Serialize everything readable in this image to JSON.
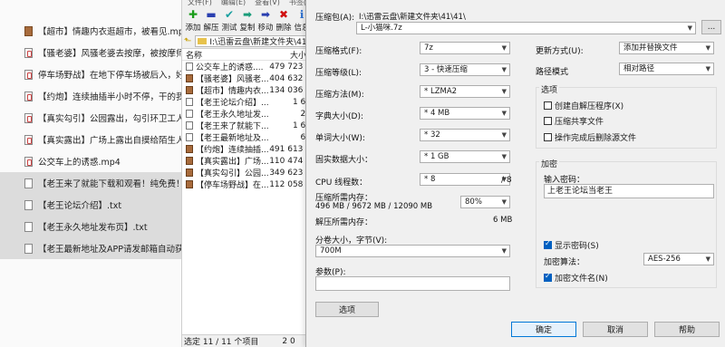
{
  "explorer": {
    "rows": [
      {
        "name": "【超市】情趣内衣逛超市，被看见.mp4",
        "type": "img",
        "selected": false
      },
      {
        "name": "【骚老婆】风骚老婆去按摩，被按摩师拿命",
        "type": "vid",
        "selected": false
      },
      {
        "name": "停车场野战】在地下停车场被后入，好刺激",
        "type": "vid",
        "selected": false
      },
      {
        "name": "【约炮】连续抽插半小时不停，干的我高潮",
        "type": "vid",
        "selected": false
      },
      {
        "name": "【真实勾引】公园露出，勾引环卫工人干我",
        "type": "vid",
        "selected": false
      },
      {
        "name": "【真实露出】广场上露出自摸给陌生人看.m",
        "type": "vid",
        "selected": false
      },
      {
        "name": "公交车上的诱惑.mp4",
        "type": "vid",
        "selected": false
      },
      {
        "name": "【老王来了就能下载和观看！纯免费！】.txt",
        "type": "txt",
        "selected": true
      },
      {
        "name": "【老王论坛介绍】.txt",
        "type": "txt",
        "selected": true
      },
      {
        "name": "【老王永久地址发布页】.txt",
        "type": "txt",
        "selected": true
      },
      {
        "name": "【老王最新地址及APP请发邮箱自动获取!",
        "type": "txt",
        "selected": true
      }
    ]
  },
  "file_manager": {
    "menu": [
      "文件(F)",
      "编辑(E)",
      "查看(V)",
      "书签(A)"
    ],
    "toolbar": [
      {
        "icon": "add-icon",
        "glyph": "✚",
        "color": "#1a9c1a",
        "label": "添加"
      },
      {
        "icon": "extract-icon",
        "glyph": "▬",
        "color": "#2a3fb0",
        "label": "解压"
      },
      {
        "icon": "test-icon",
        "glyph": "✔",
        "color": "#1aa0a0",
        "label": "测试"
      },
      {
        "icon": "copy-icon",
        "glyph": "➡",
        "color": "#1a9c7a",
        "label": "复制"
      },
      {
        "icon": "move-icon",
        "glyph": "➡",
        "color": "#2a3fb0",
        "label": "移动"
      },
      {
        "icon": "delete-icon",
        "glyph": "✖",
        "color": "#d01010",
        "label": "删除"
      },
      {
        "icon": "info-icon",
        "glyph": "ℹ",
        "color": "#2a6fd0",
        "label": "信息"
      }
    ],
    "address": "I:\\迅雷云盘\\新建文件夹\\41\\",
    "columns": {
      "name": "名称",
      "size": "大小"
    },
    "files": [
      {
        "name": "公交车上的诱惑....",
        "size": "479 723 6",
        "type": "plain"
      },
      {
        "name": "【骚老婆】风骚老...",
        "size": "404 632 7",
        "type": "img"
      },
      {
        "name": "【超市】情趣内衣...",
        "size": "134 036 4",
        "type": "img"
      },
      {
        "name": "【老王论坛介绍】...",
        "size": "1 65",
        "type": "plain"
      },
      {
        "name": "【老王永久地址发...",
        "size": "28",
        "type": "plain"
      },
      {
        "name": "【老王来了就能下...",
        "size": "1 66",
        "type": "plain"
      },
      {
        "name": "【老王最新地址及...",
        "size": "61",
        "type": "plain"
      },
      {
        "name": "【约炮】连续抽插...",
        "size": "491 613 2",
        "type": "img"
      },
      {
        "name": "【真实露出】广场...",
        "size": "110 474 5",
        "type": "img"
      },
      {
        "name": "【真实勾引】公园...",
        "size": "349 623 6",
        "type": "img"
      },
      {
        "name": "【停车场野战】在...",
        "size": "112 058 7",
        "type": "img"
      }
    ],
    "status": {
      "selection": "选定 11 / 11 个项目",
      "size": "2 0"
    }
  },
  "dialog": {
    "archive_label": "压缩包(A):",
    "archive_path": "I:\\迅雷云盘\\新建文件夹\\41\\41\\",
    "archive_name": "L-小猫咪.7z",
    "browse_label": "...",
    "format_label": "压缩格式(F):",
    "format_value": "7z",
    "level_label": "压缩等级(L):",
    "level_value": "3 - 快速压缩",
    "method_label": "压缩方法(M):",
    "method_value": "* LZMA2",
    "dict_label": "字典大小(D):",
    "dict_value": "* 4 MB",
    "word_label": "单词大小(W):",
    "word_value": "* 32",
    "solid_label": "固实数据大小：",
    "solid_value": "* 1 GB",
    "cpu_label": "CPU 线程数：",
    "cpu_value": "* 8",
    "cpu_max": "/ 8",
    "mem_comp_label": "压缩所需内存：",
    "mem_comp_value": "496 MB / 9672 MB / 12090 MB",
    "mem_percent": "80%",
    "mem_decomp_label": "解压所需内存：",
    "mem_decomp_value": "6 MB",
    "split_label": "分卷大小，字节(V):",
    "split_value": "700M",
    "params_label": "参数(P):",
    "params_value": "",
    "options_button": "选项",
    "update_label": "更新方式(U):",
    "update_value": "添加并替换文件",
    "path_label": "路径模式",
    "path_value": "相对路径",
    "options_title": "选项",
    "opt_sfx": {
      "label": "创建自解压程序(X)",
      "checked": false
    },
    "opt_shared": {
      "label": "压缩共享文件",
      "checked": false
    },
    "opt_delete": {
      "label": "操作完成后删除源文件",
      "checked": false
    },
    "encrypt_title": "加密",
    "password_label": "输入密码：",
    "password_value": "上老王论坛当老王",
    "show_password": {
      "label": "显示密码(S)",
      "checked": true
    },
    "enc_method_label": "加密算法：",
    "enc_method_value": "AES-256",
    "encrypt_names": {
      "label": "加密文件名(N)",
      "checked": true
    },
    "ok_button": "确定",
    "cancel_button": "取消",
    "help_button": "帮助"
  }
}
